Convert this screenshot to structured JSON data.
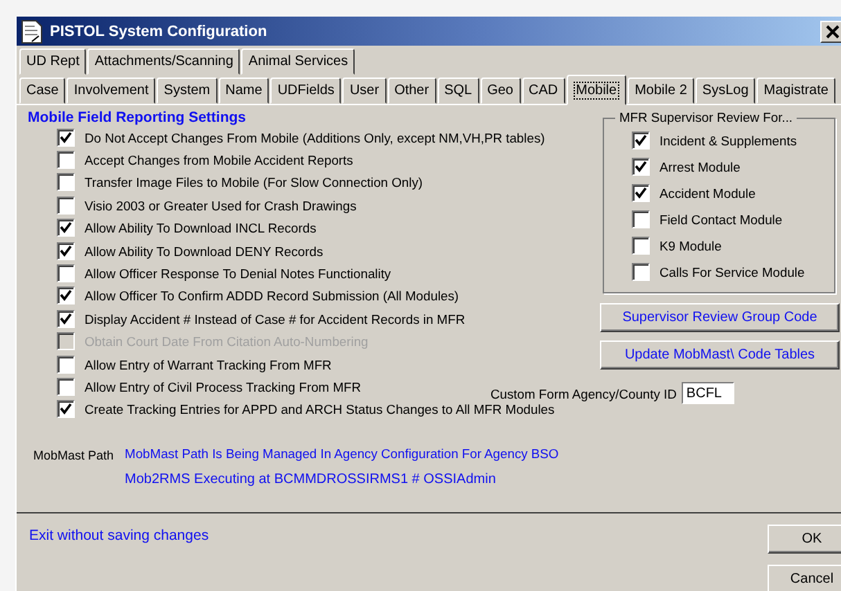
{
  "window": {
    "title": "PISTOL System Configuration"
  },
  "tab_rows": [
    [
      {
        "label": "UD Rept",
        "selected": false
      },
      {
        "label": "Attachments/Scanning",
        "selected": false
      },
      {
        "label": "Animal Services",
        "selected": false
      }
    ],
    [
      {
        "label": "Case",
        "selected": false
      },
      {
        "label": "Involvement",
        "selected": false
      },
      {
        "label": "System",
        "selected": false
      },
      {
        "label": "Name",
        "selected": false
      },
      {
        "label": "UDFields",
        "selected": false
      },
      {
        "label": "User",
        "selected": false
      },
      {
        "label": "Other",
        "selected": false
      },
      {
        "label": "SQL",
        "selected": false
      },
      {
        "label": "Geo",
        "selected": false
      },
      {
        "label": "CAD",
        "selected": false
      },
      {
        "label": "Mobile",
        "selected": true
      },
      {
        "label": "Mobile 2",
        "selected": false
      },
      {
        "label": "SysLog",
        "selected": false
      },
      {
        "label": "Magistrate",
        "selected": false
      }
    ]
  ],
  "section_title": "Mobile Field Reporting Settings",
  "options": [
    {
      "label": "Do Not Accept Changes From Mobile (Additions Only, except NM,VH,PR tables)",
      "checked": true,
      "disabled": false
    },
    {
      "label": "Accept Changes from Mobile Accident Reports",
      "checked": false,
      "disabled": false
    },
    {
      "label": "Transfer Image Files to Mobile (For Slow Connection Only)",
      "checked": false,
      "disabled": false
    },
    {
      "label": "Visio 2003 or Greater Used for Crash Drawings",
      "checked": false,
      "disabled": false
    },
    {
      "label": "Allow Ability To Download INCL Records",
      "checked": true,
      "disabled": false
    },
    {
      "label": "Allow Ability To Download DENY Records",
      "checked": true,
      "disabled": false
    },
    {
      "label": "Allow Officer Response To Denial Notes Functionality",
      "checked": false,
      "disabled": false
    },
    {
      "label": "Allow Officer To Confirm ADDD Record Submission (All Modules)",
      "checked": true,
      "disabled": false
    },
    {
      "label": "Display Accident # Instead of Case # for Accident Records in MFR",
      "checked": true,
      "disabled": false
    },
    {
      "label": "Obtain Court Date From Citation Auto-Numbering",
      "checked": false,
      "disabled": true
    },
    {
      "label": "Allow Entry of Warrant Tracking From MFR",
      "checked": false,
      "disabled": false
    },
    {
      "label": "Allow Entry of Civil Process Tracking From MFR",
      "checked": false,
      "disabled": false
    },
    {
      "label": "Create Tracking Entries for APPD and ARCH Status Changes to All MFR Modules",
      "checked": true,
      "disabled": false
    }
  ],
  "supervisor_review": {
    "title": "MFR Supervisor Review For...",
    "items": [
      {
        "label": "Incident & Supplements",
        "checked": true
      },
      {
        "label": "Arrest Module",
        "checked": true
      },
      {
        "label": "Accident Module",
        "checked": true
      },
      {
        "label": "Field Contact Module",
        "checked": false
      },
      {
        "label": "K9 Module",
        "checked": false
      },
      {
        "label": "Calls For Service Module",
        "checked": false
      }
    ]
  },
  "action_buttons": [
    "Supervisor Review Group Code",
    "Update MobMast\\ Code Tables"
  ],
  "custom_form": {
    "label": "Custom Form Agency/County ID",
    "value": "BCFL"
  },
  "mobmast": {
    "label": "MobMast Path",
    "path_note": "MobMast Path Is Being Managed In Agency Configuration For Agency BSO",
    "executing": "Mob2RMS Executing at BCMMDROSSIRMS1 # OSSIAdmin"
  },
  "exit_link": "Exit without saving changes",
  "buttons": [
    "OK",
    "Cancel"
  ]
}
